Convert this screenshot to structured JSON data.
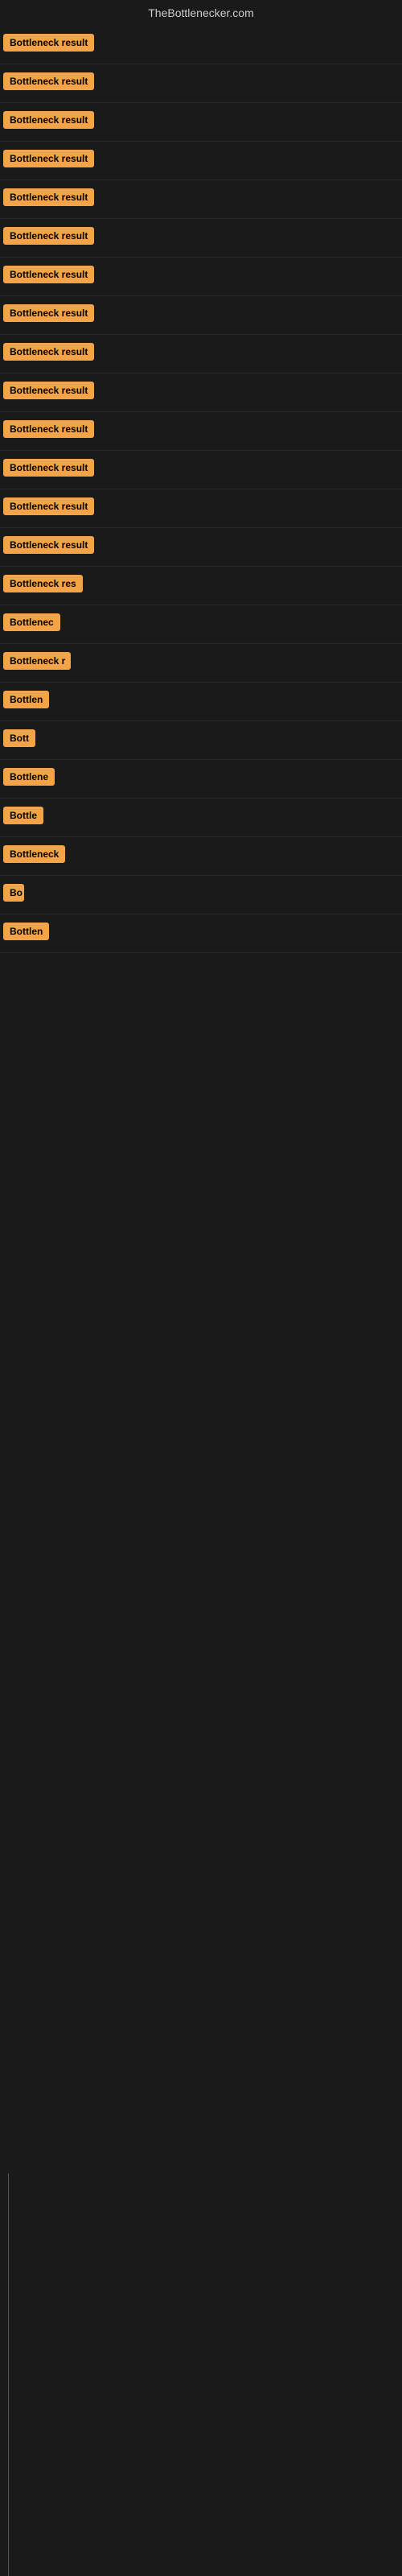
{
  "site": {
    "title": "TheBottlenecker.com"
  },
  "results": [
    {
      "id": 1,
      "label": "Bottleneck result",
      "width": 120
    },
    {
      "id": 2,
      "label": "Bottleneck result",
      "width": 120
    },
    {
      "id": 3,
      "label": "Bottleneck result",
      "width": 120
    },
    {
      "id": 4,
      "label": "Bottleneck result",
      "width": 120
    },
    {
      "id": 5,
      "label": "Bottleneck result",
      "width": 120
    },
    {
      "id": 6,
      "label": "Bottleneck result",
      "width": 120
    },
    {
      "id": 7,
      "label": "Bottleneck result",
      "width": 120
    },
    {
      "id": 8,
      "label": "Bottleneck result",
      "width": 120
    },
    {
      "id": 9,
      "label": "Bottleneck result",
      "width": 120
    },
    {
      "id": 10,
      "label": "Bottleneck result",
      "width": 120
    },
    {
      "id": 11,
      "label": "Bottleneck result",
      "width": 120
    },
    {
      "id": 12,
      "label": "Bottleneck result",
      "width": 120
    },
    {
      "id": 13,
      "label": "Bottleneck result",
      "width": 120
    },
    {
      "id": 14,
      "label": "Bottleneck result",
      "width": 120
    },
    {
      "id": 15,
      "label": "Bottleneck res",
      "width": 100
    },
    {
      "id": 16,
      "label": "Bottlenec",
      "width": 74
    },
    {
      "id": 17,
      "label": "Bottleneck r",
      "width": 84
    },
    {
      "id": 18,
      "label": "Bottlen",
      "width": 60
    },
    {
      "id": 19,
      "label": "Bott",
      "width": 40
    },
    {
      "id": 20,
      "label": "Bottlene",
      "width": 66
    },
    {
      "id": 21,
      "label": "Bottle",
      "width": 52
    },
    {
      "id": 22,
      "label": "Bottleneck",
      "width": 78
    },
    {
      "id": 23,
      "label": "Bo",
      "width": 26
    },
    {
      "id": 24,
      "label": "Bottlen",
      "width": 60
    }
  ]
}
